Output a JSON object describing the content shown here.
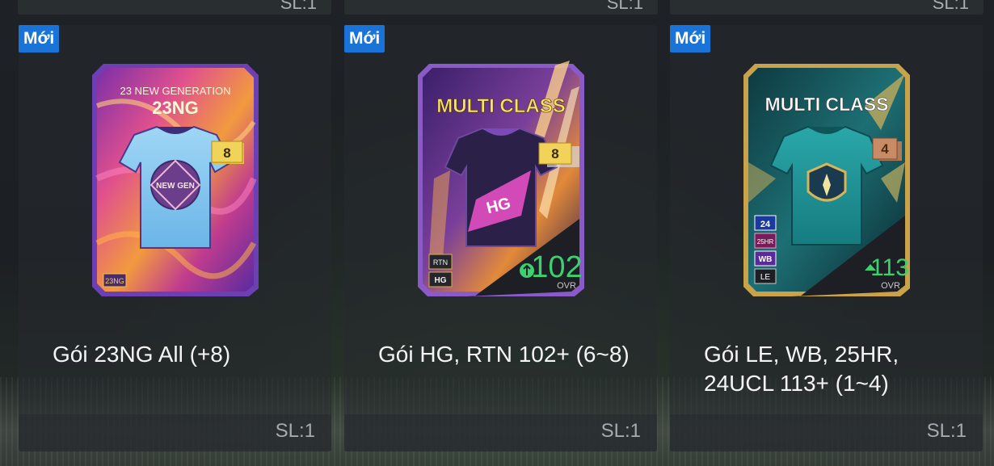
{
  "top_row": {
    "quantity": "SL:1"
  },
  "packs": [
    {
      "badge": "Mới",
      "card_subtitle": "23 NEW GENERATION",
      "card_title": "23NG",
      "level": "8",
      "tag": "23NG",
      "crest_text": "NEW GEN",
      "title": "Gói 23NG All (+8)",
      "quantity": "SL:1"
    },
    {
      "badge": "Mới",
      "card_title": "MULTI CLASS",
      "level": "8",
      "tags": [
        "RTN",
        "HG"
      ],
      "ovr_value": "102",
      "ovr_label": "OVR",
      "crest_text": "HG",
      "title": "Gói HG, RTN 102+ (6~8)",
      "quantity": "SL:1"
    },
    {
      "badge": "Mới",
      "card_title": "MULTI CLASS",
      "level": "4",
      "tags": [
        "24",
        "25HR",
        "WB",
        "LE"
      ],
      "ovr_value": "113",
      "ovr_label": "OVR",
      "title": "Gói LE, WB, 25HR, 24UCL 113+ (1~4)",
      "quantity": "SL:1"
    }
  ],
  "colors": {
    "badge_blue": "#1a74d8",
    "ovr_green": "#3bd16f",
    "gold": "#e8c341",
    "bronze": "#c98b65"
  }
}
